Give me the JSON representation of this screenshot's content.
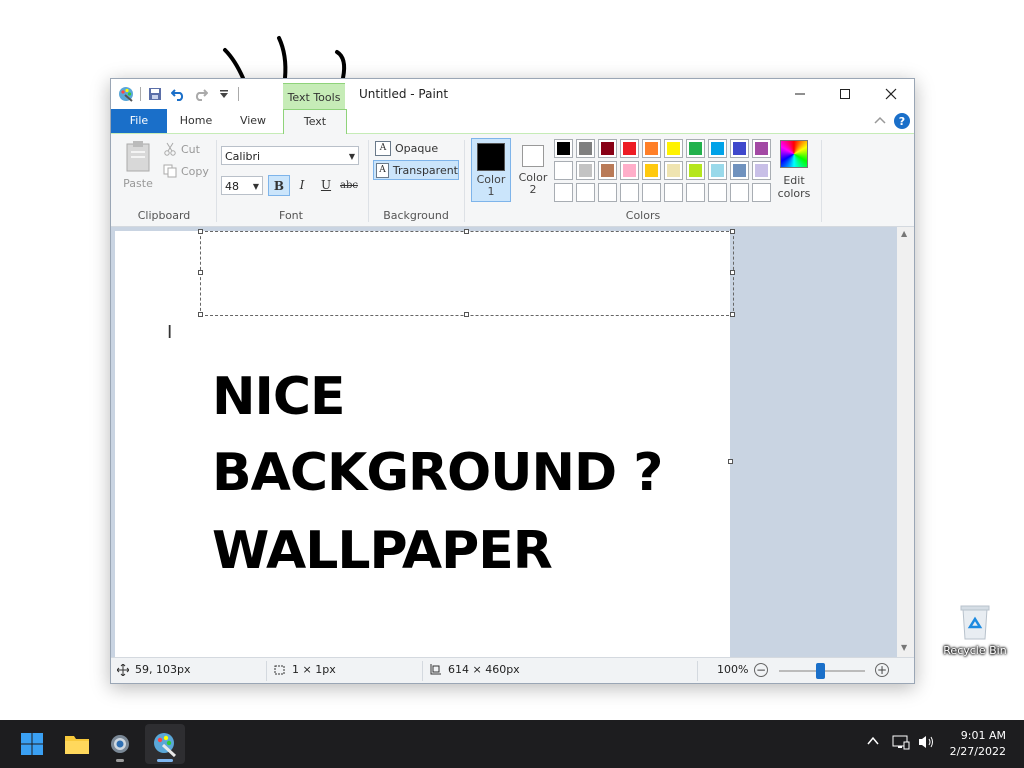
{
  "window": {
    "title": "Untitled - Paint",
    "contextual_tab": "Text Tools"
  },
  "tabs": [
    {
      "label": "File"
    },
    {
      "label": "Home"
    },
    {
      "label": "View"
    },
    {
      "label": "Text"
    }
  ],
  "clipboard": {
    "paste": "Paste",
    "cut": "Cut",
    "copy": "Copy",
    "group_label": "Clipboard"
  },
  "font": {
    "family": "Calibri",
    "size": "48",
    "bold": "B",
    "italic": "I",
    "underline": "U",
    "strikethrough": "abc",
    "group_label": "Font"
  },
  "background": {
    "opaque": "Opaque",
    "transparent": "Transparent",
    "group_label": "Background"
  },
  "colors": {
    "color1_line1": "Color",
    "color1_line2": "1",
    "color2_line1": "Color",
    "color2_line2": "2",
    "edit_line1": "Edit",
    "edit_line2": "colors",
    "group_label": "Colors",
    "color1": "#000000",
    "color2": "#ffffff",
    "palette": [
      "#000000",
      "#7f7f7f",
      "#880015",
      "#ed1c24",
      "#ff7f27",
      "#fff200",
      "#22b14c",
      "#00a2e8",
      "#3f48cc",
      "#a349a4",
      "#ffffff",
      "#c3c3c3",
      "#b97a57",
      "#ffaec9",
      "#ffc90e",
      "#efe4b0",
      "#b5e61d",
      "#99d9ea",
      "#7092be",
      "#c8bfe7",
      "",
      "",
      "",
      "",
      "",
      "",
      "",
      "",
      "",
      ""
    ]
  },
  "canvas": {
    "line1": "NICE",
    "line2": "BACKGROUND ?",
    "line3": "WALLPAPER"
  },
  "status": {
    "cursor_pos": "59, 103px",
    "selection_size": "1 × 1px",
    "image_size": "614 × 460px",
    "zoom": "100%"
  },
  "desktop": {
    "recycle_bin": "Recycle Bin"
  },
  "taskbar": {
    "time": "9:01 AM",
    "date": "2/27/2022"
  }
}
